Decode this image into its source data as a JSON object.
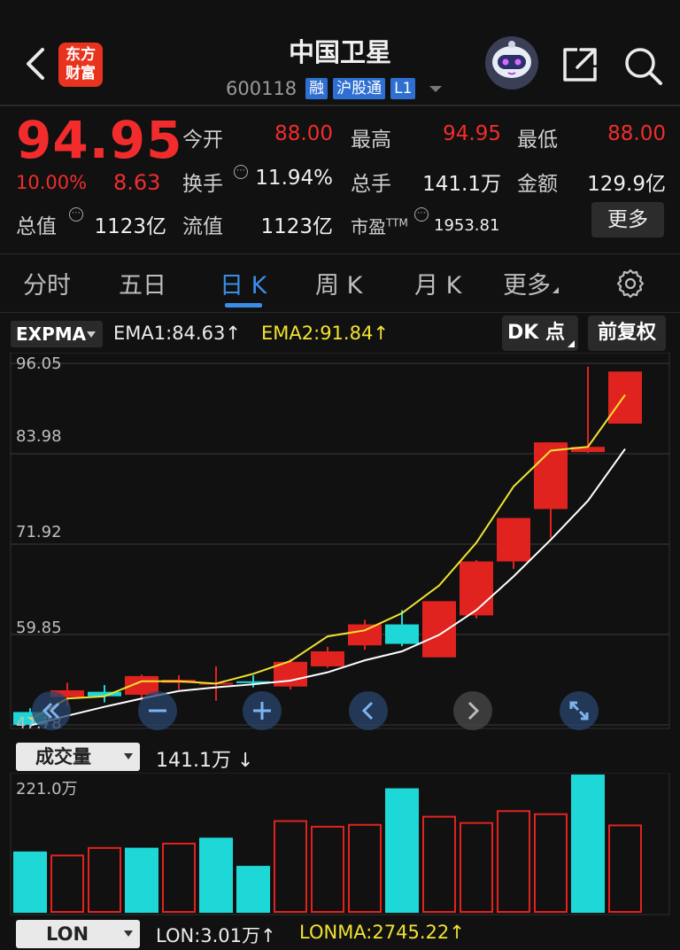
{
  "header": {
    "title": "中国卫星",
    "code": "600118",
    "tags": [
      "融",
      "沪股通",
      "L1"
    ],
    "logo_line1": "东方",
    "logo_line2": "财富"
  },
  "quote": {
    "price": "94.95",
    "change_pct": "10.00%",
    "change": "8.63",
    "fields": [
      {
        "label": "今开",
        "value": "88.00",
        "color": "red"
      },
      {
        "label": "最高",
        "value": "94.95",
        "color": "red"
      },
      {
        "label": "最低",
        "value": "88.00",
        "color": "red"
      },
      {
        "label": "换手",
        "value": "11.94%",
        "color": "white"
      },
      {
        "label": "总手",
        "value": "141.1万",
        "color": "white"
      },
      {
        "label": "金额",
        "value": "129.9亿",
        "color": "white"
      },
      {
        "label": "总值",
        "value": "1123亿",
        "color": "white"
      },
      {
        "label": "流值",
        "value": "1123亿",
        "color": "white"
      },
      {
        "label": "市盈",
        "label_sup": "TTM",
        "value": "1953.81",
        "color": "white"
      }
    ],
    "more_label": "更多"
  },
  "tabs": [
    {
      "label": "分时",
      "active": false
    },
    {
      "label": "五日",
      "active": false
    },
    {
      "label": "日 K",
      "active": true
    },
    {
      "label": "周 K",
      "active": false
    },
    {
      "label": "月 K",
      "active": false
    },
    {
      "label": "更多",
      "active": false
    }
  ],
  "indicator": {
    "name": "EXPMA",
    "ema1": "EMA1:84.63",
    "ema1_arrow": "↑",
    "ema2": "EMA2:91.84",
    "ema2_arrow": "↑",
    "dk_label": "DK 点",
    "adjust_label": "前复权"
  },
  "chart_data": {
    "type": "candlestick",
    "y_ticks": [
      "96.05",
      "83.98",
      "71.92",
      "59.85",
      "47.78"
    ],
    "ylim": [
      47.78,
      96.05
    ],
    "colors": {
      "up": "#e0231f",
      "down": "#1ed8d8",
      "ema1": "#ffffff",
      "ema2": "#f2e232"
    },
    "candles": [
      {
        "open": 49.5,
        "close": 47.8,
        "high": 50.0,
        "low": 47.5
      },
      {
        "open": 51.5,
        "close": 52.4,
        "high": 53.4,
        "low": 50.2
      },
      {
        "open": 52.2,
        "close": 51.6,
        "high": 53.1,
        "low": 50.8
      },
      {
        "open": 51.8,
        "close": 54.3,
        "high": 54.5,
        "low": 51.0
      },
      {
        "open": 53.4,
        "close": 53.8,
        "high": 54.4,
        "low": 52.5
      },
      {
        "open": 53.4,
        "close": 53.4,
        "high": 55.6,
        "low": 51.0
      },
      {
        "open": 53.6,
        "close": 53.4,
        "high": 54.4,
        "low": 52.8
      },
      {
        "open": 52.9,
        "close": 56.2,
        "high": 56.6,
        "low": 52.5
      },
      {
        "open": 55.6,
        "close": 57.6,
        "high": 58.2,
        "low": 55.4
      },
      {
        "open": 58.4,
        "close": 61.2,
        "high": 61.8,
        "low": 57.8
      },
      {
        "open": 61.2,
        "close": 58.6,
        "high": 63.1,
        "low": 58.3
      },
      {
        "open": 56.8,
        "close": 64.3,
        "high": 64.3,
        "low": 56.8
      },
      {
        "open": 62.4,
        "close": 69.6,
        "high": 69.8,
        "low": 62.0
      },
      {
        "open": 69.6,
        "close": 75.4,
        "high": 75.4,
        "low": 68.6
      },
      {
        "open": 76.6,
        "close": 85.5,
        "high": 85.5,
        "low": 72.8
      },
      {
        "open": 84.2,
        "close": 84.9,
        "high": 95.6,
        "low": 84.1
      },
      {
        "open": 88.0,
        "close": 94.95,
        "high": 94.95,
        "low": 88.0
      }
    ],
    "ema1": [
      47.7,
      49.0,
      50.2,
      51.3,
      52.3,
      52.8,
      53.2,
      53.7,
      54.8,
      56.4,
      57.6,
      59.8,
      63.1,
      67.6,
      72.5,
      77.7,
      84.63
    ],
    "ema2": [
      48.5,
      51.3,
      51.6,
      53.6,
      53.6,
      53.3,
      54.6,
      56.3,
      59.6,
      60.4,
      62.7,
      66.4,
      72.1,
      79.6,
      84.4,
      84.9,
      91.84
    ],
    "volume_ticks": [
      "221.0万"
    ],
    "volume": {
      "ylim": [
        0,
        221.0
      ],
      "values": [
        98,
        93,
        105,
        104,
        112,
        120,
        75,
        148,
        139,
        142,
        199,
        155,
        145,
        164,
        159,
        221,
        141.1
      ],
      "direction": [
        "down",
        "up",
        "up",
        "down",
        "up",
        "down",
        "down",
        "up",
        "up",
        "up",
        "down",
        "up",
        "up",
        "up",
        "up",
        "down",
        "up"
      ]
    }
  },
  "volume_panel": {
    "name": "成交量",
    "value": "141.1万",
    "arrow": "↓"
  },
  "lon_panel": {
    "name": "LON",
    "lon": "LON:3.01万",
    "lon_arrow": "↑",
    "lonma": "LONMA:2745.22",
    "lonma_arrow": "↑"
  }
}
